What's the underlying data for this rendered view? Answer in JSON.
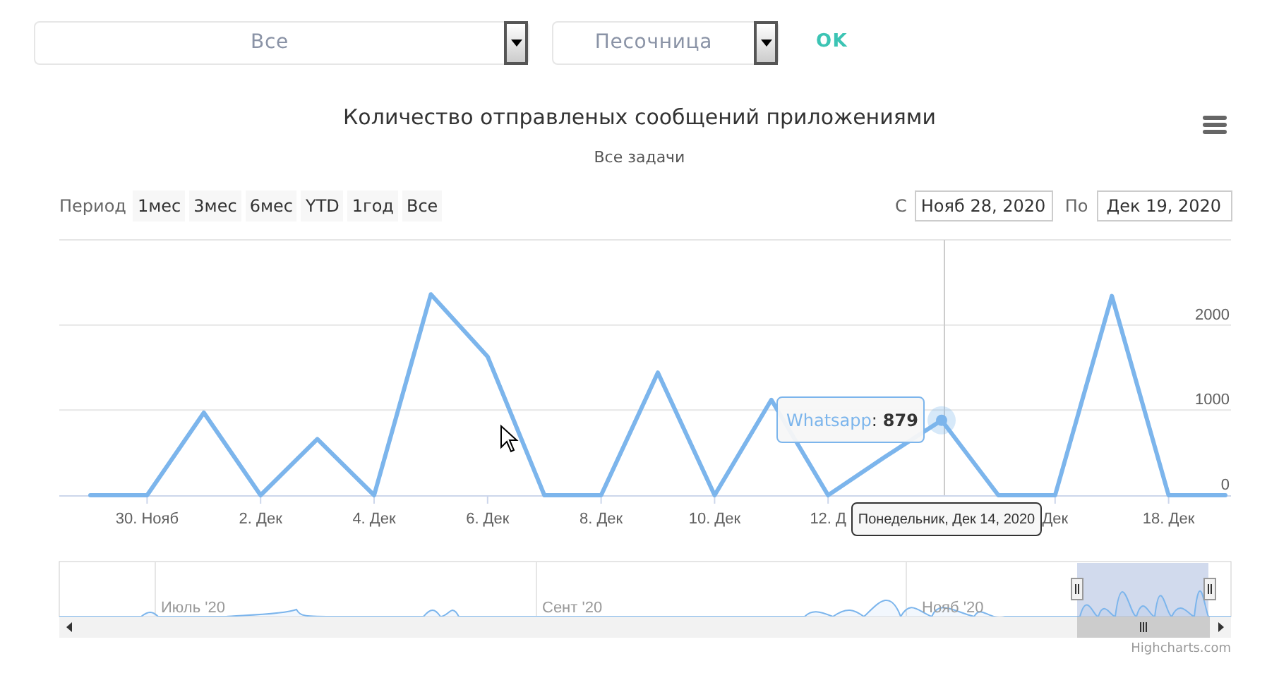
{
  "filters": [
    {
      "value": "Все"
    },
    {
      "value": "Песочница"
    }
  ],
  "ok_button": "OK",
  "chart": {
    "title": "Количество отправленых сообщений приложениями",
    "subtitle": "Все задачи",
    "range_selector": {
      "label": "Период",
      "buttons": [
        {
          "label": "1мес",
          "selected": false
        },
        {
          "label": "3мес",
          "selected": false
        },
        {
          "label": "6мес",
          "selected": false
        },
        {
          "label": "YTD",
          "selected": false
        },
        {
          "label": "1год",
          "selected": false
        },
        {
          "label": "Все",
          "selected": false
        }
      ]
    },
    "date_from": {
      "label": "С",
      "value": "Нояб 28, 2020"
    },
    "date_to": {
      "label": "По",
      "value": "Дек 19, 2020"
    },
    "chart_data": {
      "type": "line",
      "categories": [
        null,
        "30. Нояб",
        null,
        "2. Дек",
        null,
        "4. Дек",
        null,
        "6. Дек",
        null,
        "8. Дек",
        null,
        "10. Дек",
        null,
        "12. Д",
        null,
        null,
        null,
        "Дек",
        null,
        "18. Дек",
        null
      ],
      "series": [
        {
          "name": "Whatsapp",
          "color": "#7cb5ec",
          "values": [
            0,
            0,
            970,
            0,
            660,
            0,
            2360,
            1630,
            0,
            0,
            1440,
            0,
            1120,
            0,
            450,
            880,
            0,
            0,
            2340,
            0,
            0
          ]
        }
      ],
      "ylim": [
        0,
        3000
      ],
      "yticks": [
        0,
        1000,
        2000
      ]
    },
    "tooltip": {
      "separator": ":",
      "value": "879",
      "date": "Понедельник, Дек 14, 2020"
    },
    "navigator": {
      "labels": [
        "Июль '20",
        "Сент '20",
        "Нояб '20"
      ]
    },
    "credits": "Highcharts.com"
  }
}
